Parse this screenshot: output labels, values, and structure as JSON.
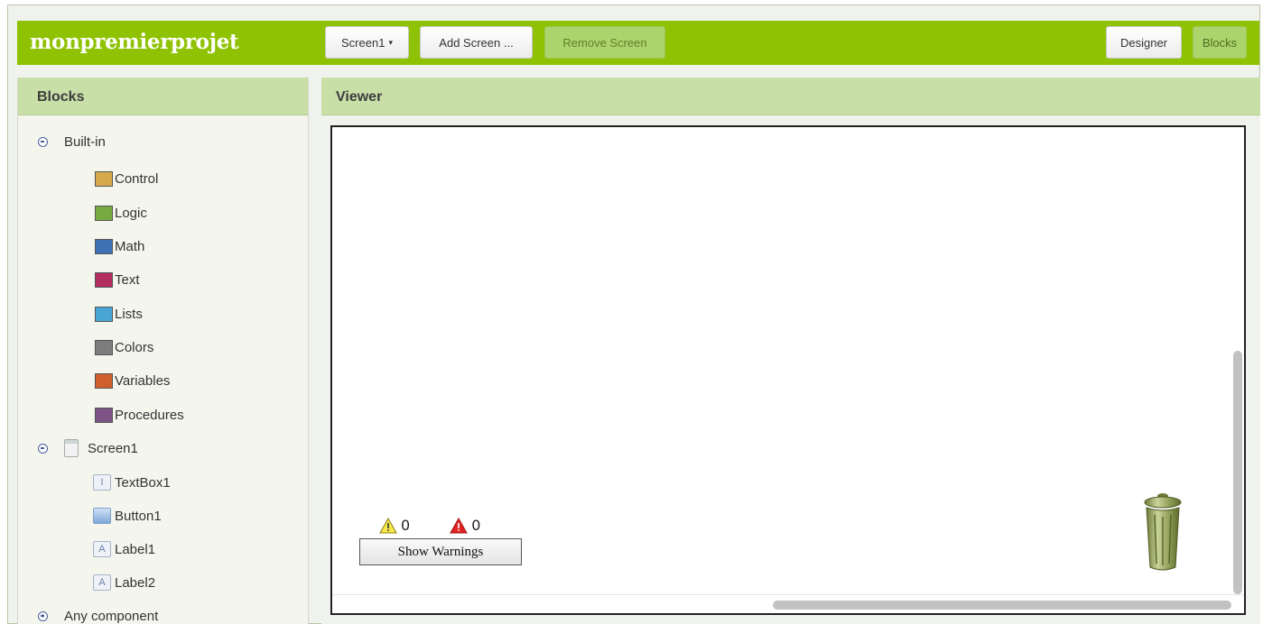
{
  "app": {
    "title": "monpremierprojet"
  },
  "toolbar": {
    "screen_select": "Screen1",
    "add_screen": "Add Screen ...",
    "remove_screen": "Remove Screen",
    "designer": "Designer",
    "blocks": "Blocks"
  },
  "blocks_panel": {
    "header": "Blocks",
    "builtin": {
      "label": "Built-in",
      "items": [
        {
          "label": "Control",
          "color": "#d6a94a"
        },
        {
          "label": "Logic",
          "color": "#77ab41"
        },
        {
          "label": "Math",
          "color": "#3f71b5"
        },
        {
          "label": "Text",
          "color": "#b32d5e"
        },
        {
          "label": "Lists",
          "color": "#49a6d4"
        },
        {
          "label": "Colors",
          "color": "#7d7d7d"
        },
        {
          "label": "Variables",
          "color": "#d05f2d"
        },
        {
          "label": "Procedures",
          "color": "#7c5385"
        }
      ]
    },
    "screen": {
      "label": "Screen1",
      "components": [
        {
          "label": "TextBox1",
          "icon": "textbox-icon"
        },
        {
          "label": "Button1",
          "icon": "button-icon"
        },
        {
          "label": "Label1",
          "icon": "label-icon"
        },
        {
          "label": "Label2",
          "icon": "label-icon"
        }
      ]
    },
    "any_component": "Any component"
  },
  "viewer": {
    "header": "Viewer",
    "warning_count": "0",
    "error_count": "0",
    "show_warnings": "Show Warnings"
  },
  "colors": {
    "topbar": "#8fc202",
    "panel_header": "#c8dfa8"
  }
}
